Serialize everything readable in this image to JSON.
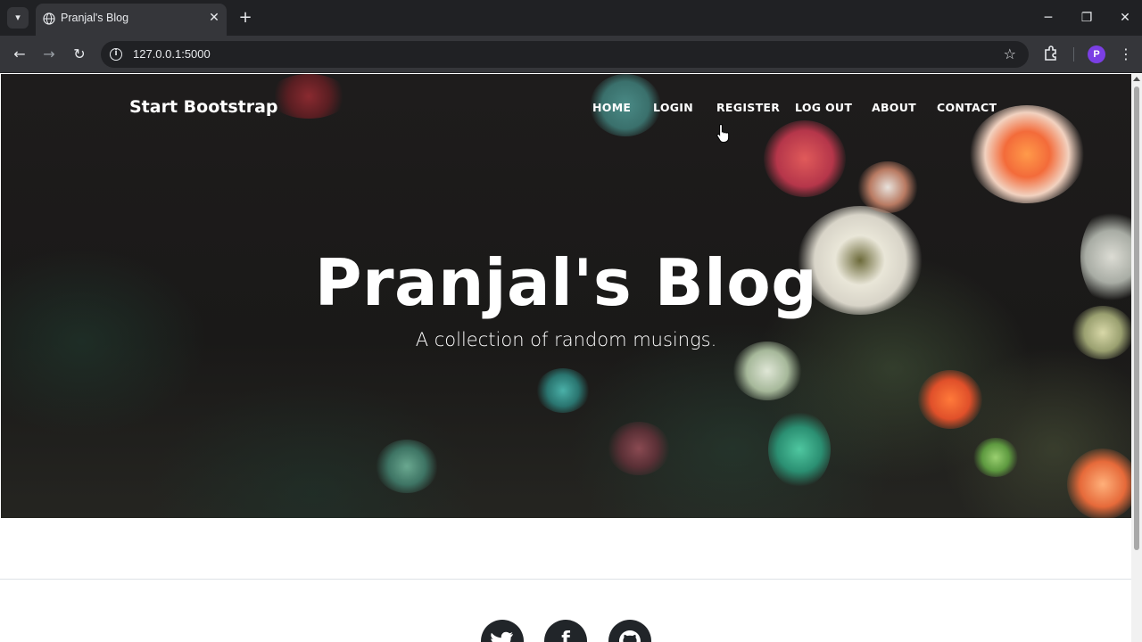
{
  "browser": {
    "tab_title": "Pranjal's Blog",
    "url": "127.0.0.1:5000",
    "profile_initial": "P"
  },
  "site": {
    "brand": "Start Bootstrap",
    "nav": [
      {
        "label": "HOME"
      },
      {
        "label": "LOGIN"
      },
      {
        "label": "REGISTER"
      },
      {
        "label": "LOG OUT"
      },
      {
        "label": "ABOUT"
      },
      {
        "label": "CONTACT"
      }
    ],
    "hero": {
      "title": "Pranjal's Blog",
      "subtitle": "A collection of random musings."
    },
    "social_icons": [
      "twitter-icon",
      "facebook-icon",
      "github-icon"
    ]
  },
  "colors": {
    "chrome_dark": "#202124",
    "chrome_toolbar": "#35363a",
    "avatar": "#7b3fe4",
    "social_bg": "#212529"
  }
}
